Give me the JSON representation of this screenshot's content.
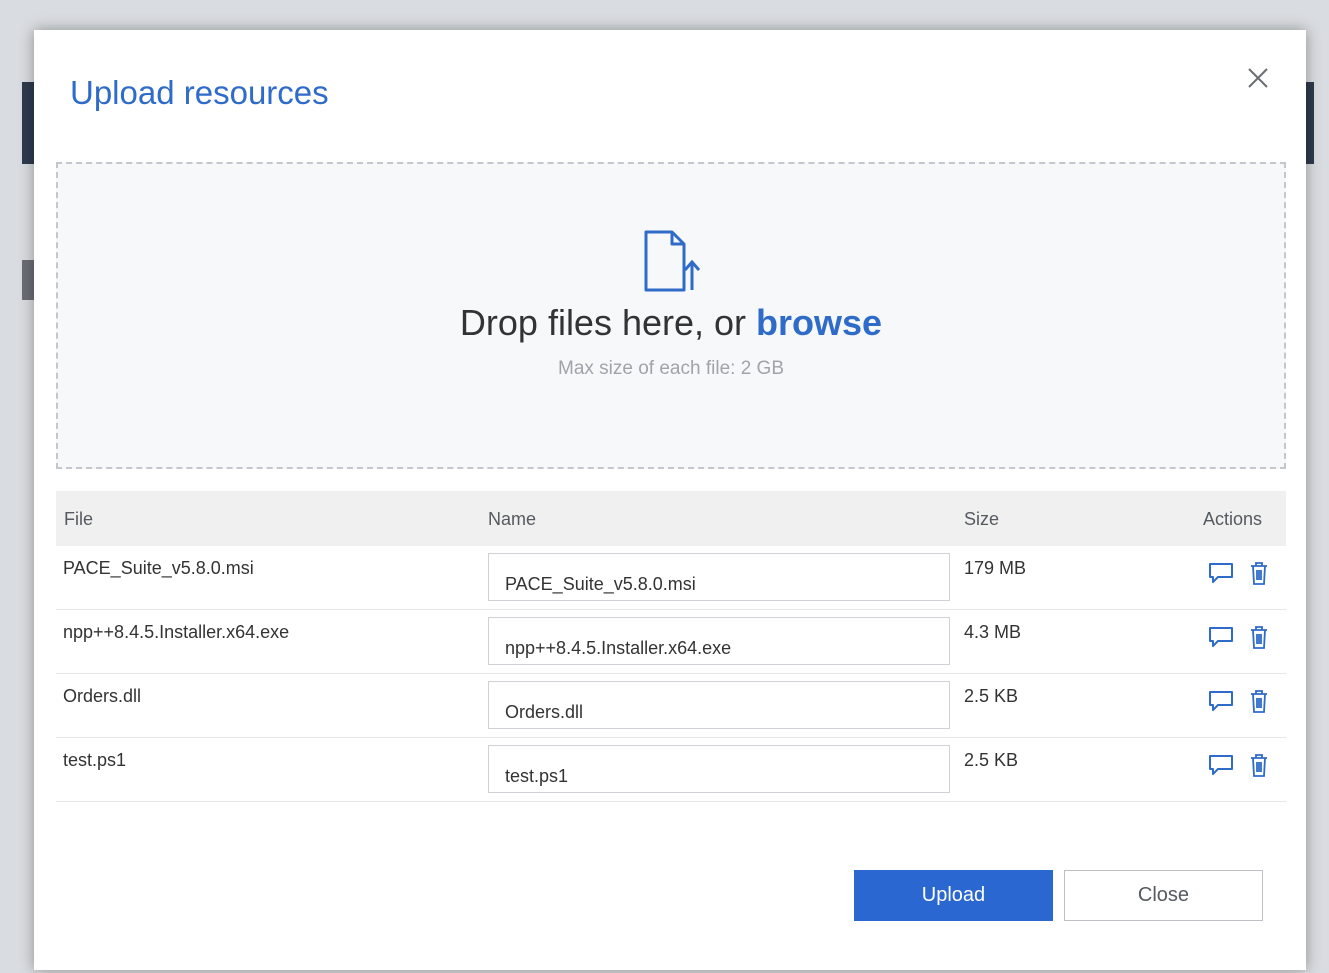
{
  "dialog": {
    "title": "Upload resources",
    "close_icon": "close-icon"
  },
  "dropzone": {
    "icon": "file-upload-icon",
    "text_prefix": "Drop files here, or ",
    "browse_label": "browse",
    "max_size": "Max size of each file: 2 GB"
  },
  "table": {
    "columns": [
      "File",
      "Name",
      "Size",
      "Actions"
    ],
    "rows": [
      {
        "file": "PACE_Suite_v5.8.0.msi",
        "name": "PACE_Suite_v5.8.0.msi",
        "size": "179 MB"
      },
      {
        "file": "npp++8.4.5.Installer.x64.exe",
        "name": "npp++8.4.5.Installer.x64.exe",
        "size": "4.3 MB"
      },
      {
        "file": "Orders.dll",
        "name": "Orders.dll",
        "size": "2.5 KB"
      },
      {
        "file": "test.ps1",
        "name": "test.ps1",
        "size": "2.5 KB"
      }
    ],
    "action_icons": [
      "comment-icon",
      "trash-icon"
    ]
  },
  "footer": {
    "upload_label": "Upload",
    "close_label": "Close"
  },
  "colors": {
    "accent": "#2f6bc9",
    "primary_button": "#2b67d1",
    "header_bg": "#f0f0f0"
  }
}
